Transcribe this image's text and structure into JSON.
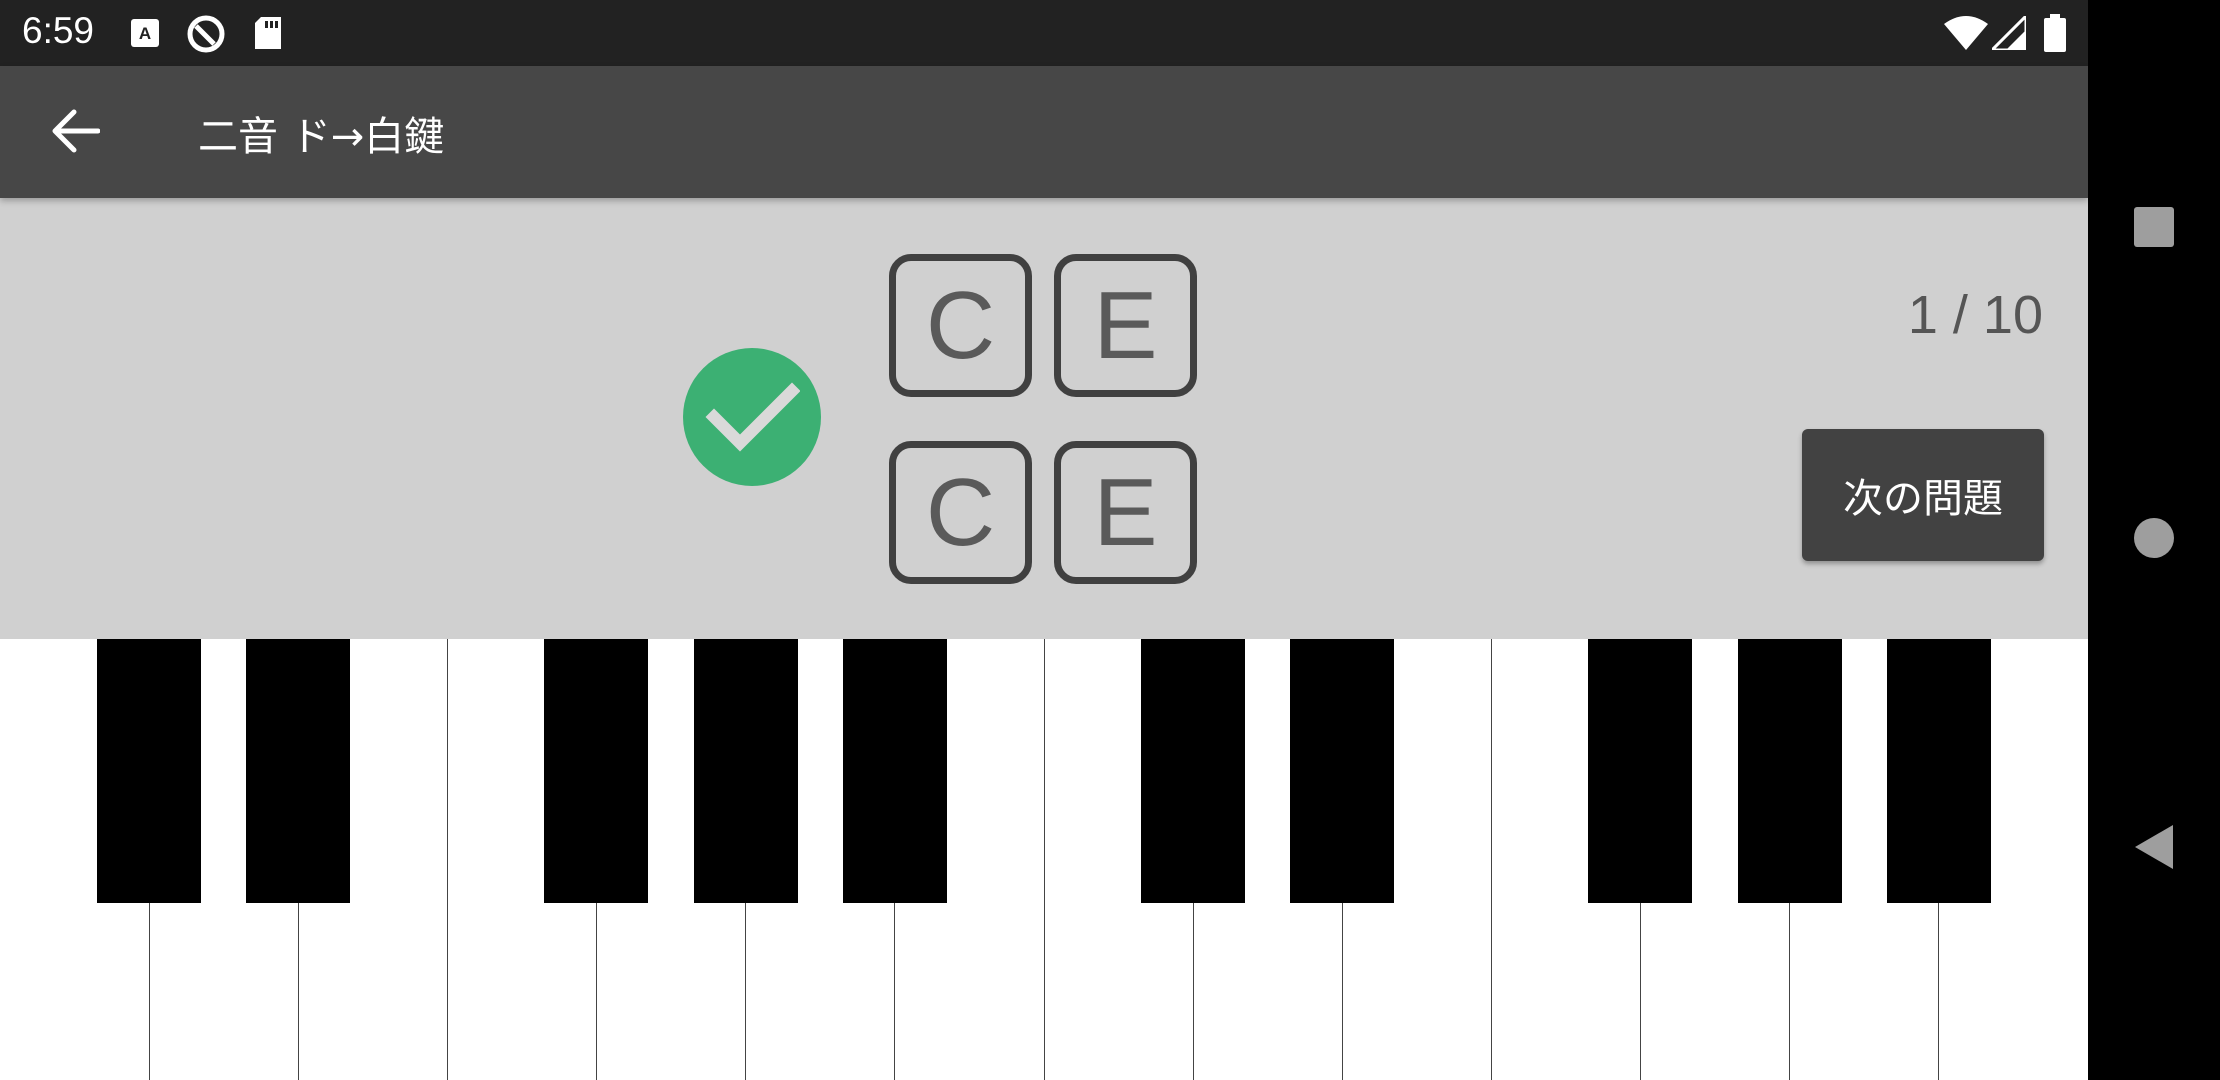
{
  "status_bar": {
    "time": "6:59",
    "left_icons": [
      "keyboard-a-icon",
      "circle-q-icon",
      "sd-card-icon"
    ],
    "right_icons": [
      "wifi-icon",
      "cell-signal-icon",
      "battery-icon"
    ]
  },
  "app_bar": {
    "back_icon": "arrow-back-icon",
    "title": "二音 ド→白鍵"
  },
  "quiz": {
    "result": "correct",
    "result_color": "#3cb073",
    "answer_row": [
      "C",
      "E"
    ],
    "question_row": [
      "C",
      "E"
    ],
    "progress": "1 / 10",
    "next_button": "次の問題"
  },
  "piano": {
    "white_keys": 14,
    "black_key_groups": "2-3-2-3-2"
  },
  "nav_bar": {
    "recents_icon": "square-recents-icon",
    "home_icon": "circle-home-icon",
    "back_icon": "triangle-back-icon"
  },
  "colors": {
    "status_bar": "#222222",
    "app_bar": "#474747",
    "panel": "#d0d0d0",
    "note_border": "#404040",
    "button": "#424242"
  }
}
